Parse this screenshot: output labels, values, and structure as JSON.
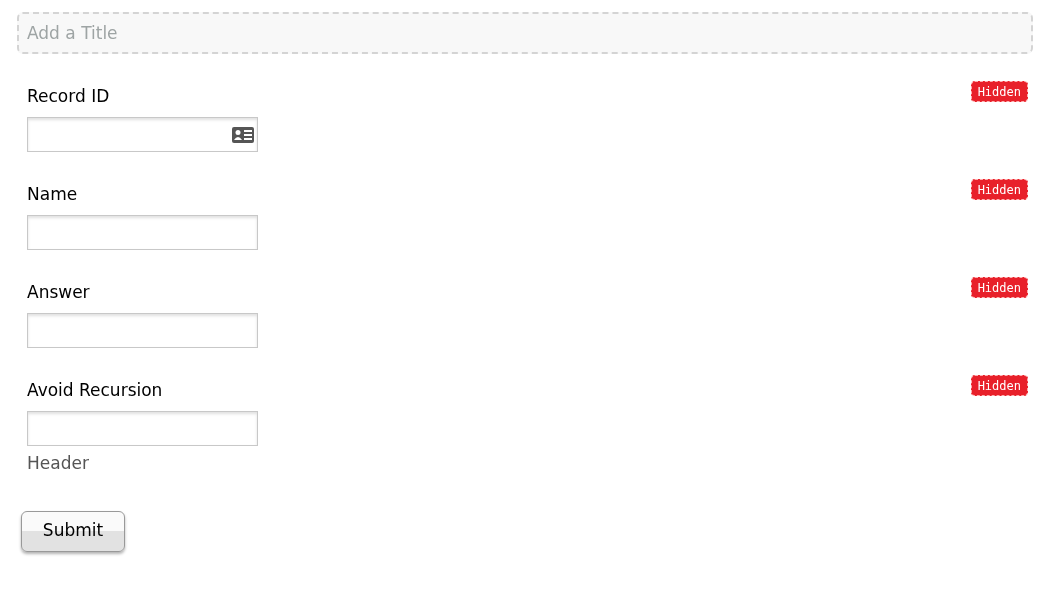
{
  "title_field": {
    "placeholder": "Add a Title"
  },
  "fields": [
    {
      "label": "Record ID",
      "kind": "id",
      "badge": "Hidden"
    },
    {
      "label": "Name",
      "kind": "text",
      "badge": "Hidden"
    },
    {
      "label": "Answer",
      "kind": "text",
      "badge": "Hidden"
    },
    {
      "label": "Avoid Recursion",
      "kind": "text",
      "badge": "Hidden"
    }
  ],
  "header": "Header",
  "submit_button": "Submit"
}
